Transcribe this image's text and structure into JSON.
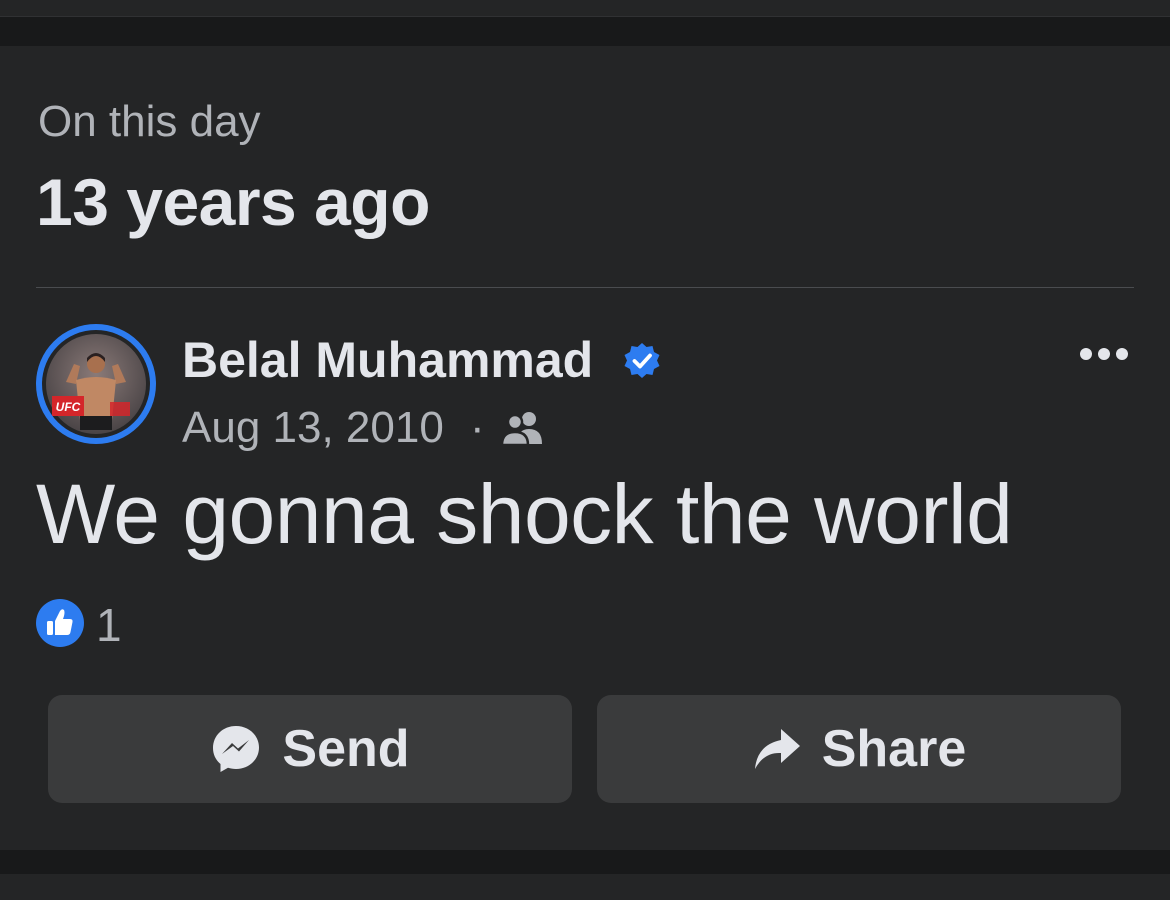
{
  "memory": {
    "label": "On this day",
    "title": "13 years ago"
  },
  "post": {
    "author": "Belal Muhammad",
    "verified": true,
    "date": "Aug 13, 2010",
    "separator": "·",
    "audience_icon": "friends-icon",
    "text": "We gonna shock the world",
    "reactions": {
      "icon": "like-icon",
      "count": "1"
    },
    "avatar_badge": "UFC"
  },
  "actions": {
    "send_label": "Send",
    "share_label": "Share"
  },
  "colors": {
    "background": "#18191a",
    "card": "#242526",
    "button": "#3a3b3c",
    "accent_blue": "#2d7cf0",
    "text_primary": "#e4e6eb",
    "text_secondary": "#b0b3b8"
  }
}
